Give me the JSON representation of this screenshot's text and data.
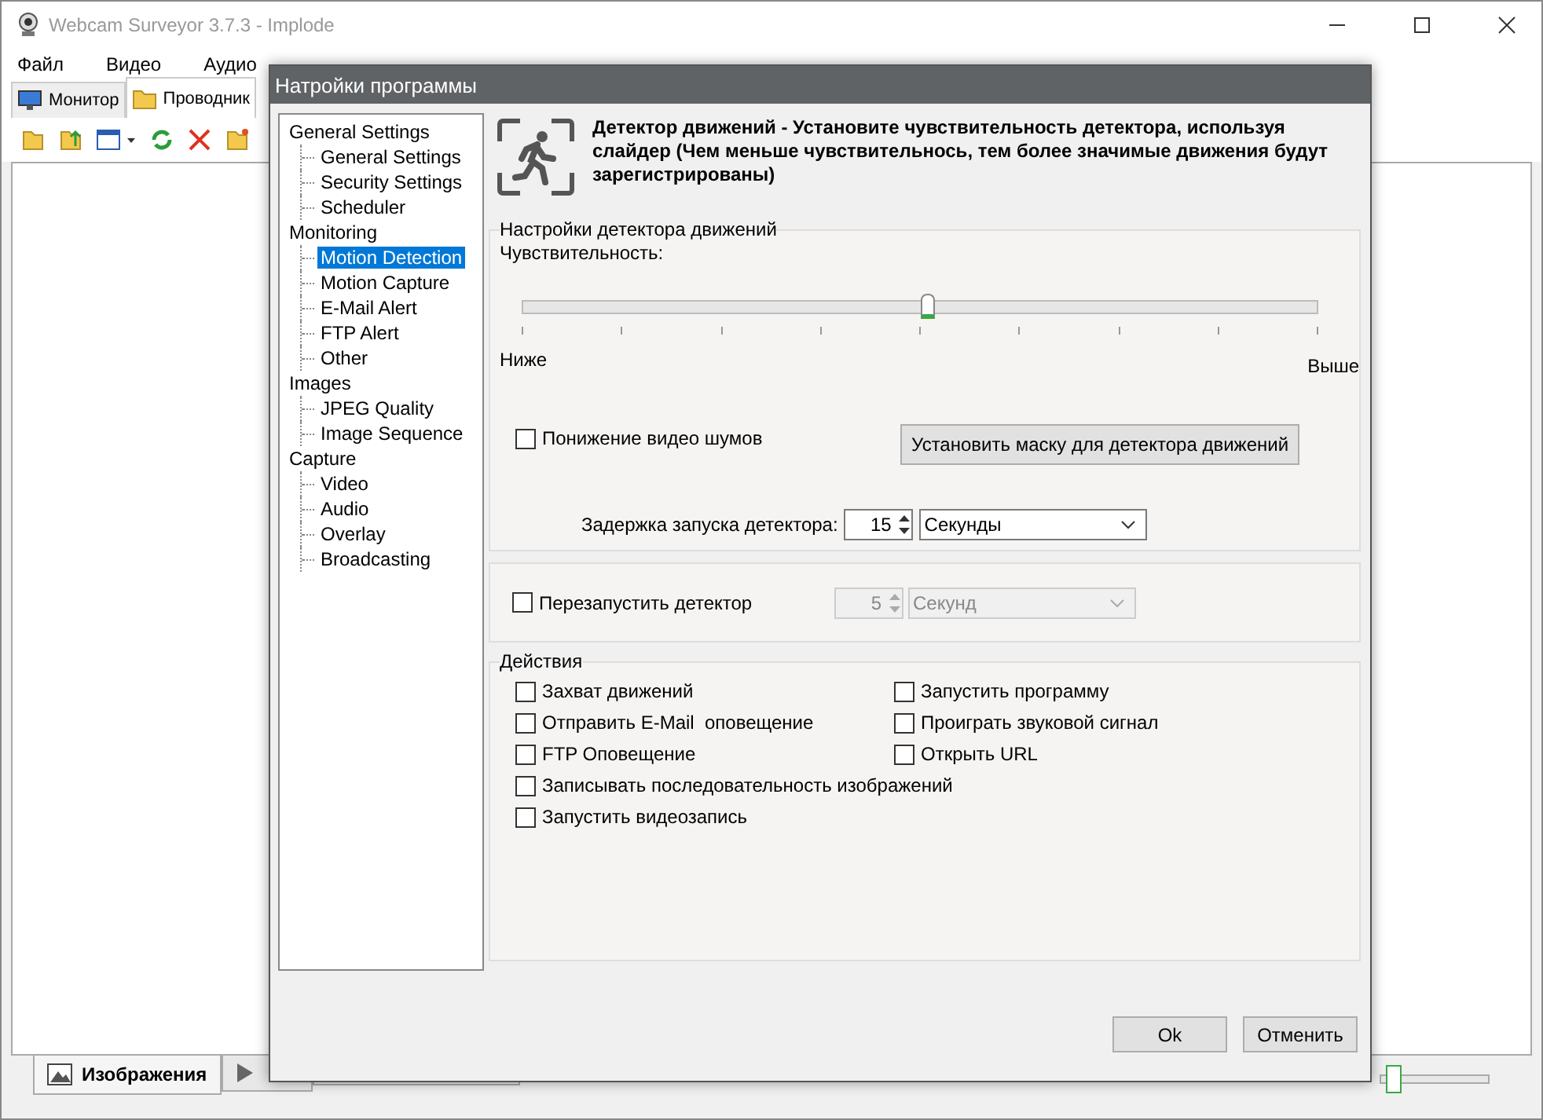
{
  "window": {
    "title": "Webcam Surveyor 3.7.3 - Implode"
  },
  "menu": [
    "Файл",
    "Видео",
    "Аудио"
  ],
  "tabs": [
    {
      "label": "Монитор",
      "selected": false
    },
    {
      "label": "Проводник",
      "selected": true
    }
  ],
  "bottom_tabs": [
    {
      "label": "Изображения",
      "selected": true
    },
    {
      "selected": false
    }
  ],
  "thumb_size": {
    "level": 0.1
  },
  "dialog": {
    "title": "Натройки программы",
    "tree": [
      {
        "label": "General Settings",
        "selected": false,
        "children": [
          {
            "label": "General Settings",
            "selected": false
          },
          {
            "label": "Security Settings",
            "selected": false
          },
          {
            "label": "Scheduler",
            "selected": false
          }
        ]
      },
      {
        "label": "Monitoring",
        "selected": false,
        "children": [
          {
            "label": "Motion Detection",
            "selected": true
          },
          {
            "label": "Motion Capture",
            "selected": false
          },
          {
            "label": "E-Mail Alert",
            "selected": false
          },
          {
            "label": "FTP Alert",
            "selected": false
          },
          {
            "label": "Other",
            "selected": false
          }
        ]
      },
      {
        "label": "Images",
        "selected": false,
        "children": [
          {
            "label": "JPEG Quality",
            "selected": false
          },
          {
            "label": "Image Sequence",
            "selected": false
          }
        ]
      },
      {
        "label": "Capture",
        "selected": false,
        "children": [
          {
            "label": "Video",
            "selected": false
          },
          {
            "label": "Audio",
            "selected": false
          },
          {
            "label": "Overlay",
            "selected": false
          },
          {
            "label": "Broadcasting",
            "selected": false
          }
        ]
      }
    ],
    "header": "Детектор движений - Установите чувствительность детектора, используя слайдер (Чем меньше чувствительнось, тем более значимые движения будут зарегистрированы)",
    "motion": {
      "title": "Настройки детектора движений",
      "sensitivity_label": "Чувствительность:",
      "level": 0.5,
      "low": "Ниже",
      "high": "Выше",
      "noise": {
        "label": "Понижение видео шумов",
        "checked": false
      },
      "mask_button": "Установить маску для детектора движений",
      "delay": {
        "label": "Задержка запуска детектора:",
        "value": "15",
        "unit": "Секунды"
      }
    },
    "restart": {
      "label": "Перезапустить детектор",
      "checked": false,
      "disabled": true,
      "value": "5",
      "unit": "Секунд"
    },
    "actions": {
      "title": "Действия",
      "left": [
        {
          "label": "Захват движений",
          "checked": false
        },
        {
          "label": "Отправить E-Mail  оповещение",
          "checked": false
        },
        {
          "label": "FTP Оповещение",
          "checked": false
        },
        {
          "label": "Записывать последовательность изображений",
          "checked": false
        },
        {
          "label": "Запустить видеозапись",
          "checked": false
        }
      ],
      "right": [
        {
          "label": "Запустить программу",
          "checked": false
        },
        {
          "label": "Проиграть звуковой сигнал",
          "checked": false
        },
        {
          "label": "Открыть URL",
          "checked": false
        }
      ]
    },
    "buttons": [
      "Ok",
      "Отменить"
    ]
  }
}
